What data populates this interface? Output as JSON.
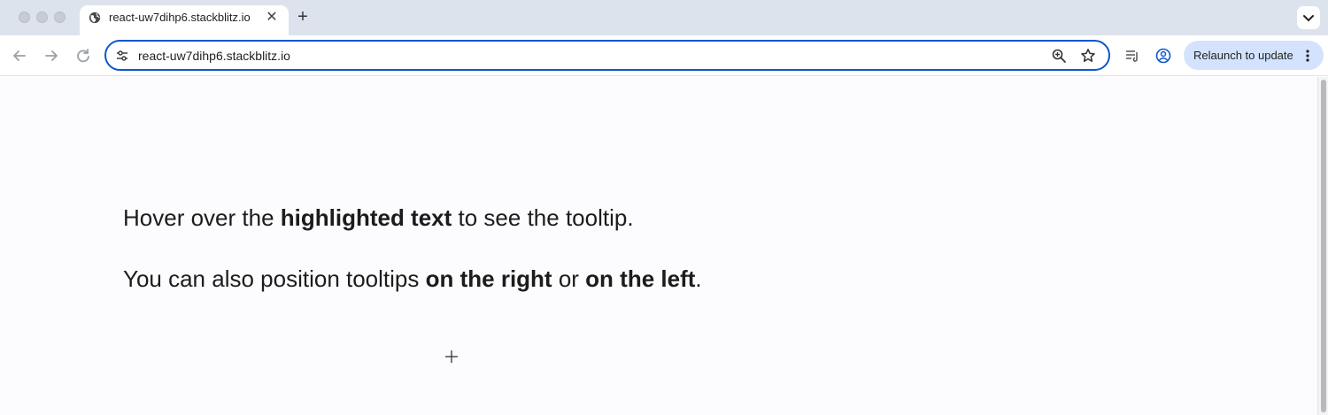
{
  "browser": {
    "tab": {
      "title": "react-uw7dihp6.stackblitz.io",
      "close_glyph": "✕",
      "favicon": "globe-icon"
    },
    "new_tab_glyph": "+",
    "url": "react-uw7dihp6.stackblitz.io",
    "relaunch_label": "Relaunch to update",
    "accent_color": "#0b57d0",
    "relaunch_bg": "#d3e3fd"
  },
  "page": {
    "line1": {
      "pre": "Hover over the ",
      "bold": "highlighted text",
      "post": " to see the tooltip."
    },
    "line2": {
      "pre": "You can also position tooltips ",
      "bold1": "on the right",
      "mid": " or ",
      "bold2": "on the left",
      "post": "."
    }
  }
}
